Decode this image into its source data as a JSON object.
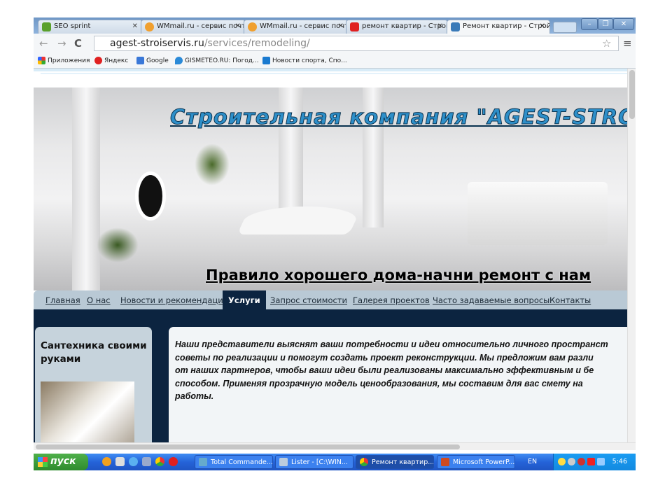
{
  "browser": {
    "tabs": [
      {
        "label": "SEO sprint",
        "icon": "seosprint-icon",
        "color": "#5aa02c"
      },
      {
        "label": "WMmail.ru - сервис почт",
        "icon": "wmmail-icon",
        "color": "#f0a030"
      },
      {
        "label": "WMmail.ru - сервис почт",
        "icon": "wmmail-icon",
        "color": "#f0a030"
      },
      {
        "label": "ремонт квартир - Строй",
        "icon": "yandex-icon",
        "color": "#e02020"
      },
      {
        "label": "Ремонт квартир - Строй",
        "icon": "site-icon",
        "color": "#3a7ab8",
        "active": true
      }
    ],
    "url_domain": "agest-stroiservis.ru",
    "url_path": "/services/remodeling/",
    "bookmarks": [
      "Приложения",
      "Яндекс",
      "Google",
      "GISMETEO.RU: Погод...",
      "Новости спорта, Спо..."
    ]
  },
  "site": {
    "title": "Строительная компания \"AGEST-STRO",
    "slogan": "Правило хорошего дома-начни ремонт с нам",
    "menu": [
      "Главная",
      "О нас",
      "Новости и рекомендации",
      "Услуги",
      "Запрос стоимости",
      "Галерея проектов",
      "Часто задаваемые вопросы",
      "Контакты"
    ],
    "active_menu": "Услуги",
    "sidebar_title": "Сантехника своими руками",
    "content": "Наши представители выяснят ваши потребности и идеи относительно личного пространст\nсоветы по реализации и помогут создать проект реконструкции. Мы предложим вам разли\nот наших партнеров, чтобы ваши идеи были реализованы максимально эффективным и бе\nспособом. Применяя прозрачную модель ценообразования, мы составим для вас смету на\nработы."
  },
  "taskbar": {
    "start": "пуск",
    "windows": [
      "Total Commande...",
      "Lister - [C:\\WIN...",
      "Ремонт квартир...",
      "Microsoft PowerP..."
    ],
    "lang": "EN",
    "clock": "5:46"
  }
}
